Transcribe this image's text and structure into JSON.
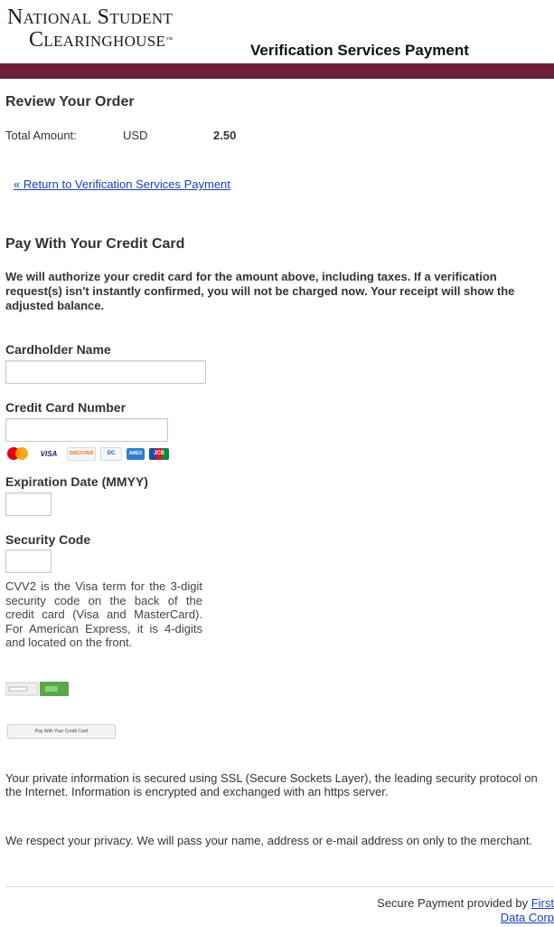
{
  "brand": {
    "line1": "National Student",
    "line2": "Clearinghouse"
  },
  "header": {
    "title": "Verification Services Payment"
  },
  "colors": {
    "accent_bar": "#6b1d3a",
    "link": "#1a3fbf"
  },
  "review": {
    "heading": "Review Your Order",
    "total_label": "Total Amount:",
    "currency": "USD",
    "amount": "2.50"
  },
  "return_link": "« Return to Verification Services Payment",
  "pay": {
    "heading": "Pay With Your Credit Card",
    "notice": "We will authorize your credit card for the amount above, including taxes. If a verification request(s) isn't instantly confirmed, you will not be charged now. Your receipt will show the adjusted balance."
  },
  "form": {
    "cardholder_label": "Cardholder Name",
    "cardholder_value": "",
    "card_number_label": "Credit Card Number",
    "card_number_value": "",
    "card_icons": [
      "mastercard-icon",
      "visa-icon",
      "discover-icon",
      "diners-icon",
      "amex-icon",
      "jcb-icon"
    ],
    "expiration_label": "Expiration Date (MMYY)",
    "expiration_value": "",
    "security_label": "Security Code",
    "security_value": "",
    "cvv_help": "CVV2 is the Visa term for the 3-digit security code on the back of the credit card (Visa and MasterCard). For American Express, it is 4-digits and located on the front.",
    "submit_label": "Pay With Your Credit Card"
  },
  "info": {
    "ssl": "Your private information is secured using SSL (Secure Sockets Layer), the leading security protocol on the Internet. Information is encrypted and exchanged with an https server.",
    "privacy": "We respect your privacy. We will pass your name, address or e-mail address on only to the merchant."
  },
  "footer": {
    "prefix": "Secure Payment provided by",
    "link_part1": "First",
    "link_part2": "Data Corp"
  }
}
